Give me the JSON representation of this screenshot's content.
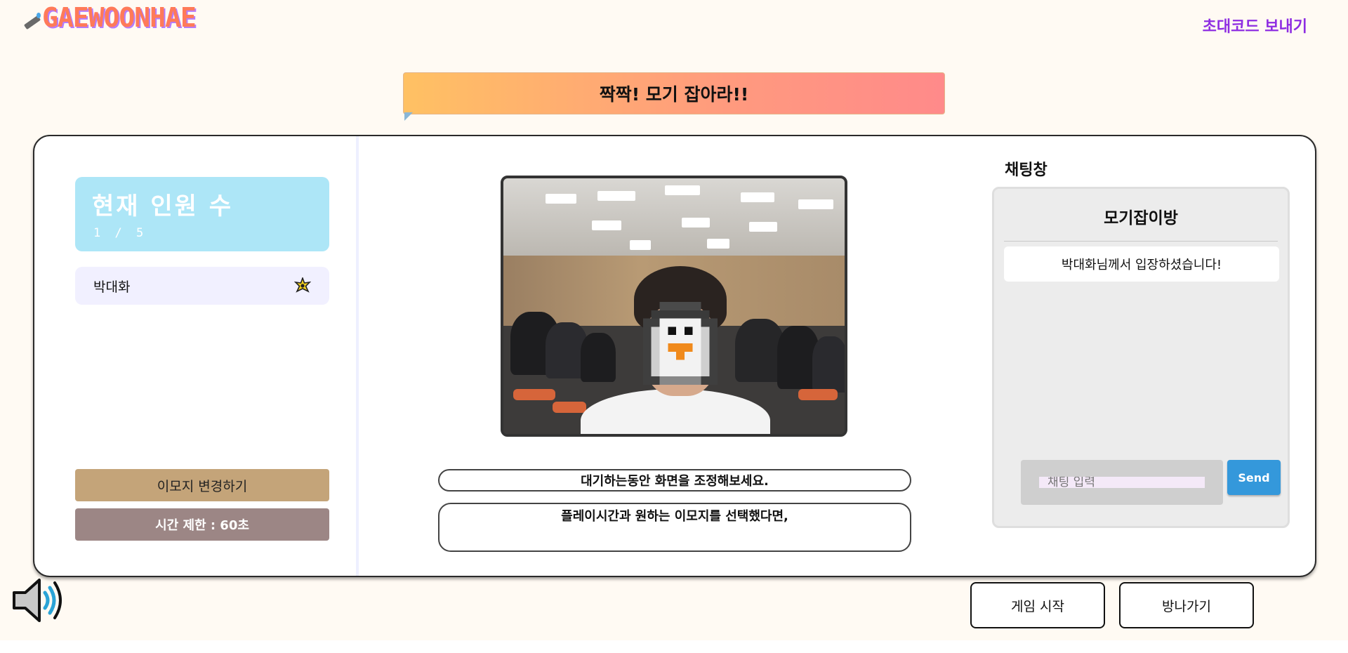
{
  "header": {
    "logo_text": "GAEWOONHAE",
    "invite_link": "초대코드 보내기"
  },
  "banner": {
    "title": "짝짝! 모기 잡아라!!"
  },
  "left_panel": {
    "count_title": "현재 인원 수",
    "count_value": "1 / 5",
    "players": [
      {
        "name": "박대화",
        "icon": "star-badge-icon"
      }
    ],
    "change_emoji_button": "이모지 변경하기",
    "time_limit_button": "시간 제한 : 60초"
  },
  "center_panel": {
    "video_icon": "camera-feed",
    "note_line1": "대기하는동안 화면을 조정해보세요.",
    "note_line2": "플레이시간과 원하는 이모지를 선택했다면,"
  },
  "chat": {
    "label": "채팅창",
    "room_title": "모기잡이방",
    "messages": [
      "박대화님께서 입장하셨습니다!"
    ],
    "input_placeholder": "채팅 입력",
    "send_label": "Send"
  },
  "footer": {
    "speaker_icon": "speaker-volume-icon",
    "start_button": "게임 시작",
    "leave_button": "방나가기"
  },
  "colors": {
    "invite": "#8e2de2",
    "count_card": "#ade6f7",
    "emoji_btn": "#c4a479",
    "time_btn": "#9c8685",
    "send_btn": "#3498db"
  }
}
